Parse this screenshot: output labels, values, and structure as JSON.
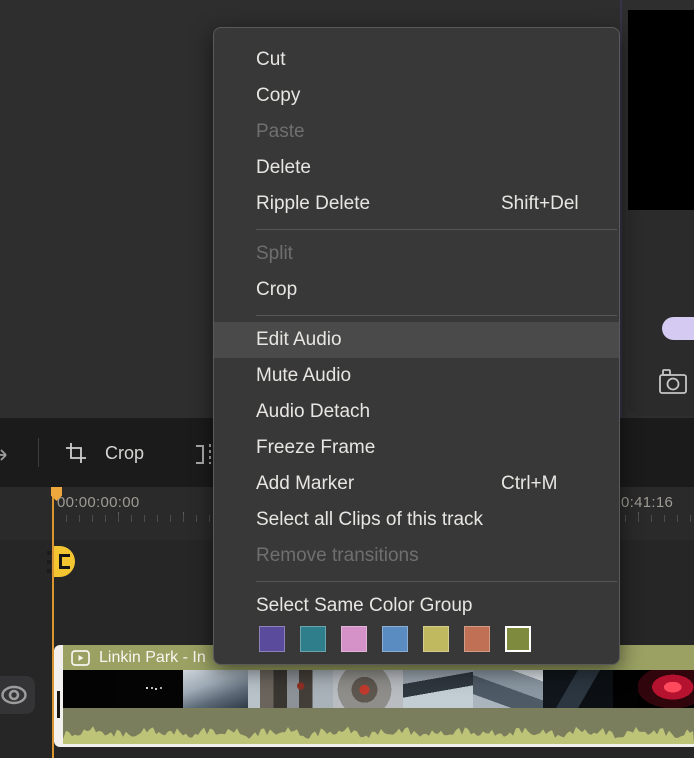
{
  "context_menu": {
    "items": [
      {
        "label": "Cut"
      },
      {
        "label": "Copy"
      },
      {
        "label": "Paste",
        "disabled": true
      },
      {
        "label": "Delete"
      },
      {
        "label": "Ripple Delete",
        "shortcut": "Shift+Del"
      },
      {
        "separator": true
      },
      {
        "label": "Split",
        "disabled": true
      },
      {
        "label": "Crop"
      },
      {
        "separator": true
      },
      {
        "label": "Edit Audio",
        "highlighted": true
      },
      {
        "label": "Mute Audio"
      },
      {
        "label": "Audio Detach"
      },
      {
        "label": "Freeze Frame"
      },
      {
        "label": "Add Marker",
        "shortcut": "Ctrl+M"
      },
      {
        "label": "Select all Clips of this track"
      },
      {
        "label": "Remove transitions",
        "disabled": true
      },
      {
        "separator": true
      },
      {
        "label": "Select Same Color Group",
        "header": true
      }
    ],
    "color_groups": [
      {
        "name": "purple",
        "hex": "#5b4b9d"
      },
      {
        "name": "teal",
        "hex": "#2e7e8b"
      },
      {
        "name": "pink",
        "hex": "#d492c9"
      },
      {
        "name": "blue",
        "hex": "#5b8cc1"
      },
      {
        "name": "yellow",
        "hex": "#c1b95f"
      },
      {
        "name": "orange",
        "hex": "#bf7055"
      },
      {
        "name": "olive",
        "hex": "#7e8a3d",
        "selected": true
      }
    ]
  },
  "toolbar": {
    "crop_label": "Crop"
  },
  "ruler": {
    "start_time": "00:00:00:00",
    "end_time": "0:41:16"
  },
  "clip": {
    "title": "Linkin Park - In",
    "header_color": "#9aa163"
  },
  "colors": {
    "playhead": "#d9952f",
    "marker_badge": "#f3c631",
    "menu_highlight": "#4a4a4a",
    "toggle": "#d5cbf2",
    "waveform": "#bdc477"
  }
}
